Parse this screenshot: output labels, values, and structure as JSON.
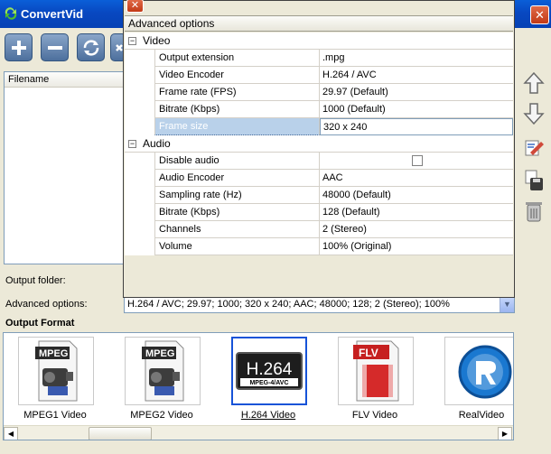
{
  "window": {
    "title": "ConvertVid",
    "close_glyph": "✕"
  },
  "toolbar": {
    "buttons": [
      {
        "name": "add-icon"
      },
      {
        "name": "remove-icon"
      },
      {
        "name": "convert-icon"
      },
      {
        "name": "stop-icon"
      }
    ]
  },
  "file_list": {
    "column_header": "Filename"
  },
  "side_panel": {
    "icons": [
      "arrow-up-icon",
      "arrow-down-icon",
      "edit-icon",
      "save-icon",
      "trash-icon"
    ]
  },
  "labels": {
    "output_folder": "Output folder:",
    "advanced_options": "Advanced options:",
    "output_format": "Output Format"
  },
  "advanced_options_value": "H.264 / AVC; 29.97; 1000; 320 x 240; AAC; 48000; 128; 2 (Stereo); 100%",
  "popup": {
    "title": "Advanced options",
    "close_glyph": "✕",
    "groups": [
      {
        "label": "Video",
        "toggle": "−",
        "rows": [
          {
            "name": "Output extension",
            "value": ".mpg"
          },
          {
            "name": "Video Encoder",
            "value": "H.264 / AVC"
          },
          {
            "name": "Frame rate (FPS)",
            "value": "29.97 (Default)"
          },
          {
            "name": "Bitrate (Kbps)",
            "value": "1000 (Default)"
          },
          {
            "name": "Frame size",
            "value": "320 x 240"
          }
        ]
      },
      {
        "label": "Audio",
        "toggle": "−",
        "rows": [
          {
            "name": "Disable audio",
            "value": ""
          },
          {
            "name": "Audio Encoder",
            "value": "AAC"
          },
          {
            "name": "Sampling rate (Hz)",
            "value": "48000 (Default)"
          },
          {
            "name": "Bitrate (Kbps)",
            "value": "128 (Default)"
          },
          {
            "name": "Channels",
            "value": "2 (Stereo)"
          },
          {
            "name": "Volume",
            "value": "100% (Original)"
          }
        ]
      }
    ]
  },
  "formats": [
    {
      "label": "MPEG1 Video",
      "badge": "MPEG",
      "icon": "mpeg-file-icon"
    },
    {
      "label": "MPEG2 Video",
      "badge": "MPEG",
      "icon": "mpeg-file-icon"
    },
    {
      "label": "H.264 Video",
      "badge": "H.264",
      "sub": "MPEG-4/AVC",
      "icon": "h264-icon",
      "selected": true
    },
    {
      "label": "FLV Video",
      "badge": "FLV",
      "icon": "flv-file-icon"
    },
    {
      "label": "RealVideo",
      "badge": "",
      "icon": "real-icon"
    }
  ],
  "scroll": {
    "left_glyph": "◀",
    "right_glyph": "▶",
    "dropdown_glyph": "▼"
  },
  "colors": {
    "titlebar": "#0848c1",
    "selection": "#1653d8",
    "accent_red": "#c23a16"
  }
}
